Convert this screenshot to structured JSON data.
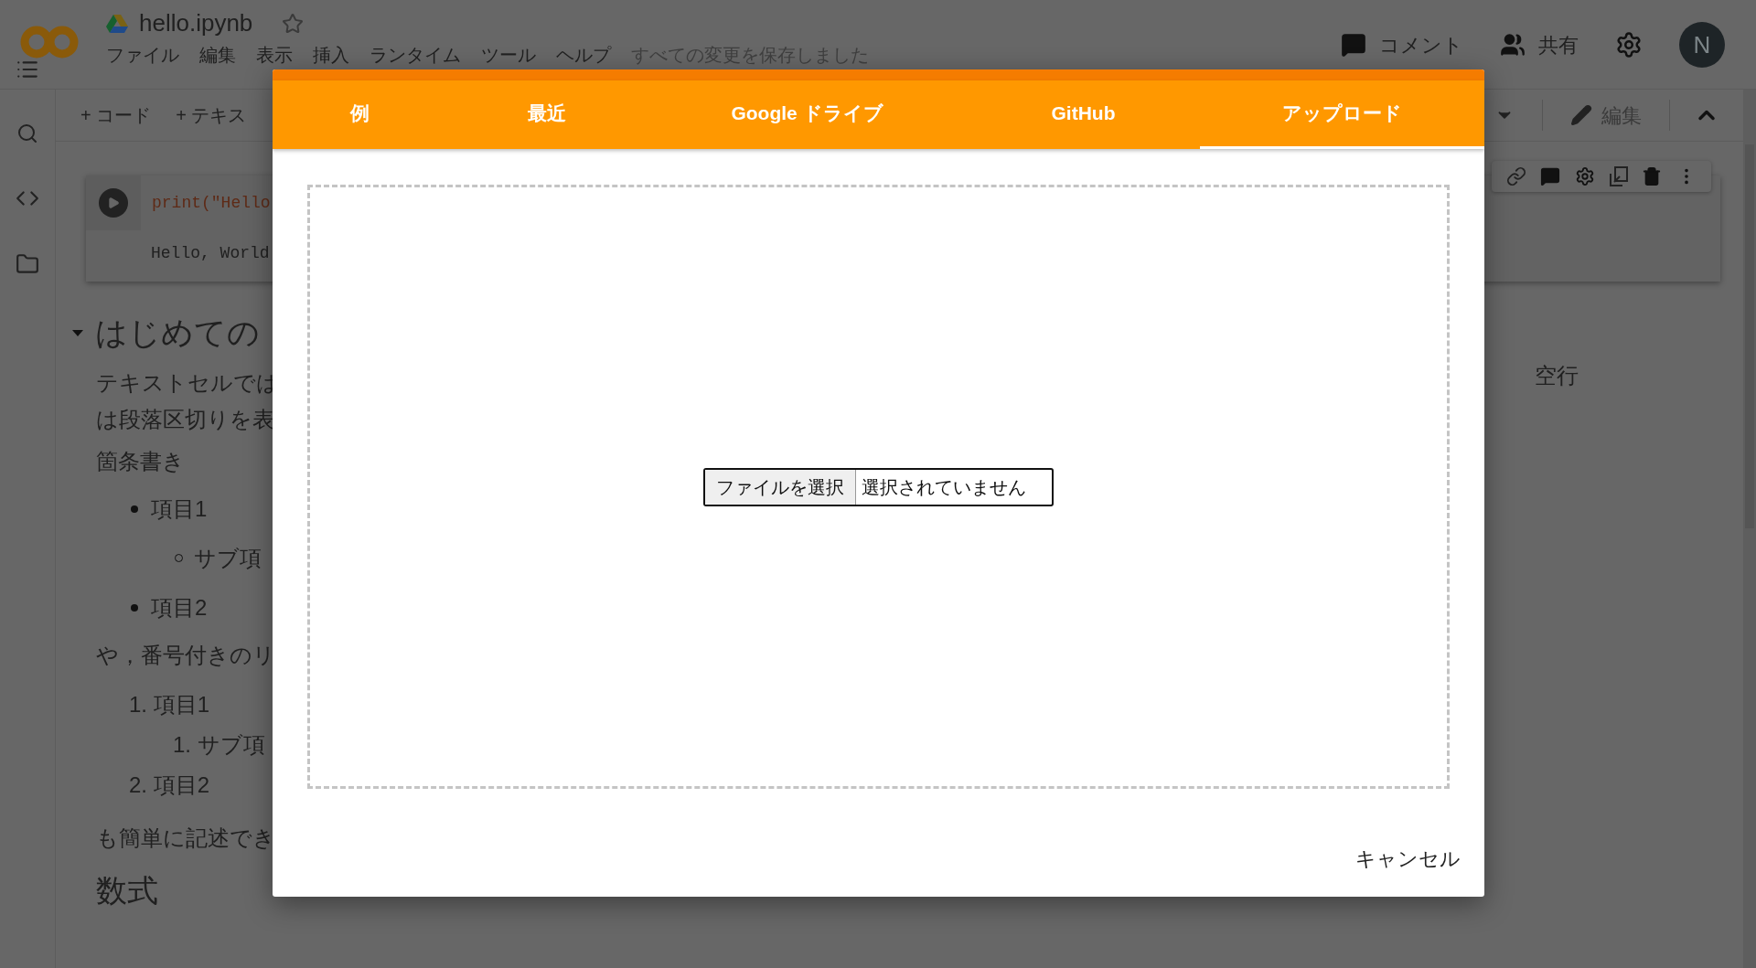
{
  "app": {
    "file_name": "hello.ipynb",
    "starred": false,
    "menu": [
      "ファイル",
      "編集",
      "表示",
      "挿入",
      "ランタイム",
      "ツール",
      "ヘルプ"
    ],
    "save_status": "すべての変更を保存しました",
    "actions": [
      {
        "kind": "comment",
        "label": "コメント"
      },
      {
        "kind": "share",
        "label": "共有"
      }
    ],
    "avatar": "N"
  },
  "toolbar": {
    "add": [
      "+ コード",
      "+ テキス"
    ],
    "edit": "編集"
  },
  "cell": {
    "code": "print(\"Hello",
    "output": "Hello, World"
  },
  "notebook": {
    "heading": "はじめての",
    "expanded": true,
    "paragraph": [
      "テキストセルでは",
      "は段落区切りを表"
    ],
    "paragraph_right": "空行",
    "bullets_label": "箇条書き",
    "bullets": [
      {
        "text": "項目1",
        "children": [
          {
            "text": "サブ項"
          }
        ]
      },
      {
        "text": "項目2"
      }
    ],
    "numbered_label": "や，番号付きのリ",
    "numbered": [
      {
        "number": "1.",
        "text": "項目1",
        "children": [
          {
            "number": "1.",
            "text": "サブ項"
          }
        ]
      },
      {
        "number": "2.",
        "text": "項目2"
      }
    ],
    "closing": "も簡単に記述でき",
    "math_heading": "数式"
  },
  "dialog": {
    "tabs": [
      {
        "label": "例",
        "selected": false
      },
      {
        "label": "最近",
        "selected": false
      },
      {
        "label": "Google ドライブ",
        "selected": false
      },
      {
        "label": "GitHub",
        "selected": false
      },
      {
        "label": "アップロード",
        "selected": true
      }
    ],
    "file_button": "ファイルを選択",
    "file_status": "選択されていません",
    "cancel": "キャンセル"
  }
}
